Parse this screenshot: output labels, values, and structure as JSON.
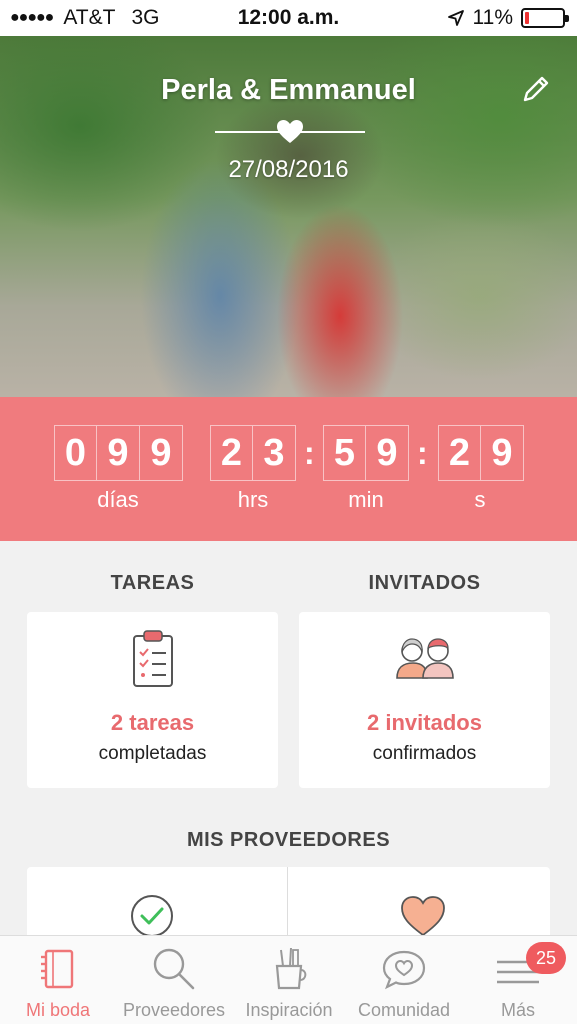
{
  "status_bar": {
    "carrier": "AT&T",
    "network": "3G",
    "time": "12:00 a.m.",
    "battery": "11%",
    "battery_level": 0.11,
    "signal_dots": "●●●●●"
  },
  "hero": {
    "title": "Perla & Emmanuel",
    "date": "27/08/2016"
  },
  "countdown": {
    "days": [
      "0",
      "9",
      "9"
    ],
    "hours": [
      "2",
      "3"
    ],
    "minutes": [
      "5",
      "9"
    ],
    "seconds": [
      "2",
      "9"
    ],
    "separator": ":",
    "labels": {
      "days": "días",
      "hours": "hrs",
      "minutes": "min",
      "seconds": "s"
    }
  },
  "tasks": {
    "heading": "TAREAS",
    "count": "2 tareas",
    "subtitle": "completadas"
  },
  "guests": {
    "heading": "INVITADOS",
    "count": "2 invitados",
    "subtitle": "confirmados"
  },
  "providers": {
    "heading": "MIS PROVEEDORES"
  },
  "tabbar": {
    "tabs": [
      {
        "label": "Mi boda",
        "icon": "notebook-icon"
      },
      {
        "label": "Proveedores",
        "icon": "search-icon"
      },
      {
        "label": "Inspiración",
        "icon": "tools-cup-icon"
      },
      {
        "label": "Comunidad",
        "icon": "chat-heart-icon"
      },
      {
        "label": "Más",
        "icon": "menu-icon",
        "badge": "25"
      }
    ]
  },
  "colors": {
    "accent": "#f07b7e",
    "accent_text": "#e86a6e",
    "background": "#f1f1f1"
  }
}
